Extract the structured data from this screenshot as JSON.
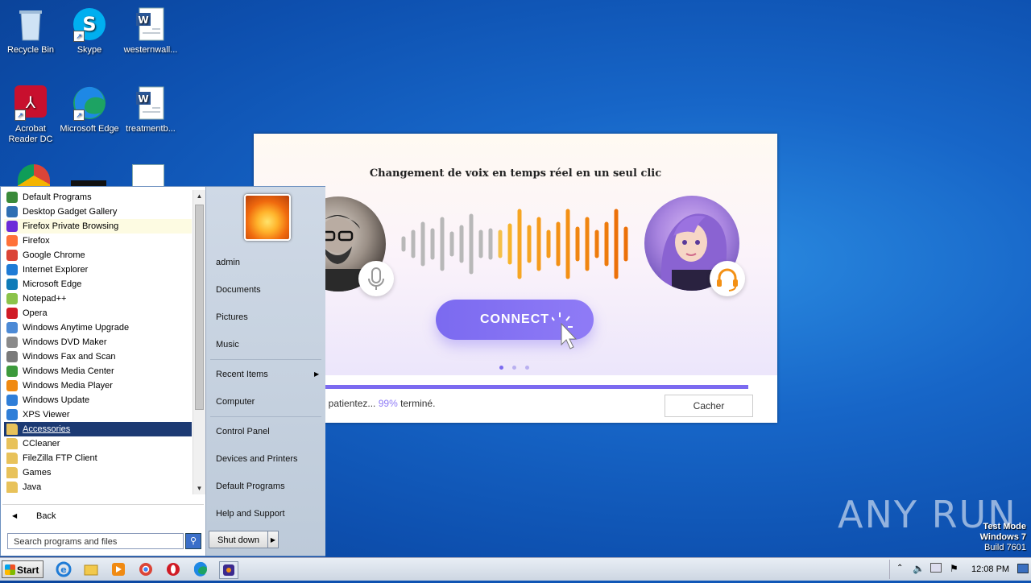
{
  "desktop": {
    "icons": [
      {
        "label": "Recycle Bin"
      },
      {
        "label": "Skype"
      },
      {
        "label": "westernwall..."
      },
      {
        "label": "Acrobat\nReader DC"
      },
      {
        "label": "Microsoft Edge"
      },
      {
        "label": "treatmentb..."
      }
    ]
  },
  "installer": {
    "tagline": "Changement de voix en temps réel en un seul clic",
    "connect_label": "CONNECT",
    "status_prefix": ", patientez...",
    "status_percent": "99%",
    "status_suffix": "terminé.",
    "progress": 0.99,
    "hide_label": "Cacher"
  },
  "start_menu": {
    "programs": [
      {
        "label": "Default Programs",
        "icon_color": "#3a8a3a"
      },
      {
        "label": "Desktop Gadget Gallery",
        "icon_color": "#2f6fb3"
      },
      {
        "label": "Firefox Private Browsing",
        "icon_color": "#6c2bd9"
      },
      {
        "label": "Firefox",
        "icon_color": "#ff7139"
      },
      {
        "label": "Google Chrome",
        "icon_color": "#db4437"
      },
      {
        "label": "Internet Explorer",
        "icon_color": "#1e7bd6"
      },
      {
        "label": "Microsoft Edge",
        "icon_color": "#0f7bb8"
      },
      {
        "label": "Notepad++",
        "icon_color": "#8bc34a"
      },
      {
        "label": "Opera",
        "icon_color": "#d01b25"
      },
      {
        "label": "Windows Anytime Upgrade",
        "icon_color": "#4c8ad6"
      },
      {
        "label": "Windows DVD Maker",
        "icon_color": "#8a8a8a"
      },
      {
        "label": "Windows Fax and Scan",
        "icon_color": "#7a7a7a"
      },
      {
        "label": "Windows Media Center",
        "icon_color": "#3c9a3c"
      },
      {
        "label": "Windows Media Player",
        "icon_color": "#f08a12"
      },
      {
        "label": "Windows Update",
        "icon_color": "#2f7ed8"
      },
      {
        "label": "XPS Viewer",
        "icon_color": "#2f7ed8"
      },
      {
        "label": "Accessories",
        "icon_color": "#e8c25a"
      },
      {
        "label": "CCleaner",
        "icon_color": "#e8c25a"
      },
      {
        "label": "FileZilla FTP Client",
        "icon_color": "#e8c25a"
      },
      {
        "label": "Games",
        "icon_color": "#e8c25a"
      },
      {
        "label": "Java",
        "icon_color": "#e8c25a"
      }
    ],
    "back_label": "Back",
    "search_placeholder": "Search programs and files",
    "right_items": {
      "user": "admin",
      "documents": "Documents",
      "pictures": "Pictures",
      "music": "Music",
      "recent": "Recent Items",
      "computer": "Computer",
      "control_panel": "Control Panel",
      "devices": "Devices and Printers",
      "default_programs": "Default Programs",
      "help": "Help and Support"
    },
    "shutdown_label": "Shut down"
  },
  "taskbar": {
    "start_label": "Start",
    "clock": "12:08 PM"
  },
  "watermark": {
    "brand": "ANY RUN",
    "test_mode": "Test Mode",
    "os": "Windows 7",
    "build": "Build 7601"
  }
}
